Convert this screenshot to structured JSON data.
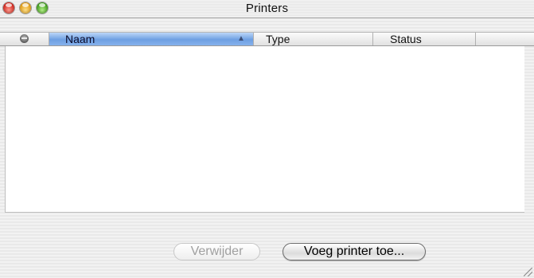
{
  "window": {
    "title": "Printers"
  },
  "columns": {
    "name": "Naam",
    "type": "Type",
    "status": "Status"
  },
  "list": {
    "rows": []
  },
  "buttons": {
    "remove": "Verwijder",
    "add": "Voeg printer toe..."
  },
  "icons": {
    "close": "close-icon",
    "minimize": "minimize-icon",
    "zoom": "zoom-icon",
    "status_column": "status-column-icon",
    "sort": "sort-ascending-icon",
    "resize": "resize-grip-icon"
  },
  "colors": {
    "selected_column": "#7aa8e8",
    "close": "#d0231a",
    "minimize": "#e29a10",
    "zoom": "#3a9a17"
  }
}
